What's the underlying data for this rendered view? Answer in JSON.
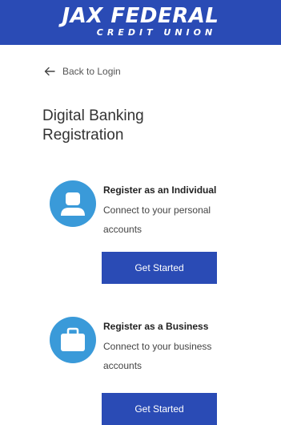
{
  "header": {
    "logo_main": "JAX FEDERAL",
    "logo_sub": "CREDIT UNION"
  },
  "back_link": {
    "label": "Back to Login",
    "icon": "arrow-left-icon"
  },
  "page_title": "Digital Banking Registration",
  "cards": {
    "individual": {
      "icon": "person-icon",
      "title": "Register as an Individual",
      "description": "Connect to your personal accounts",
      "button_label": "Get Started"
    },
    "business": {
      "icon": "briefcase-icon",
      "title": "Register as a Business",
      "description": "Connect to your business accounts",
      "button_label": "Get Started"
    }
  },
  "colors": {
    "brand": "#2a4bb5",
    "icon_bg": "#3a9ad9",
    "text": "#333333"
  }
}
